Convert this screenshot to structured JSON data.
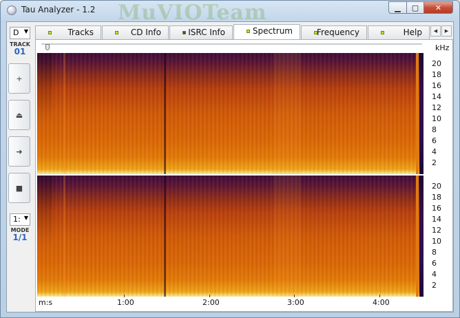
{
  "window": {
    "title": "Tau Analyzer - 1.2",
    "watermark": "MuVIOTeam"
  },
  "left_panel": {
    "drive_value": "D",
    "track_label": "TRACK",
    "track_value": "01",
    "mode_select_value": "1:",
    "mode_label": "MODE",
    "mode_value": "1/1",
    "buttons": [
      {
        "icon": "plus-icon",
        "glyph": "+"
      },
      {
        "icon": "eject-icon",
        "glyph": "⏏"
      },
      {
        "icon": "play-icon",
        "glyph": "➜"
      },
      {
        "icon": "stop-icon",
        "glyph": "■"
      }
    ]
  },
  "tabs": [
    {
      "label": "Tracks",
      "led_color": "#c8e800"
    },
    {
      "label": "CD Info",
      "led_color": "#c8e800"
    },
    {
      "label": "ISRC Info",
      "led_color": "#4a4a4a"
    },
    {
      "label": "Spectrum",
      "led_color": "#c8e800",
      "active": true
    },
    {
      "label": "Frequency",
      "led_color": "#c8e800"
    },
    {
      "label": "Help",
      "led_color": "#c8e800"
    }
  ],
  "spectrum": {
    "unit_label": "kHz",
    "freq_ticks": [
      "20",
      "18",
      "16",
      "14",
      "12",
      "10",
      "8",
      "6",
      "4",
      "2"
    ],
    "time_axis_label": "m:s",
    "time_ticks": [
      "1:00",
      "2:00",
      "3:00",
      "4:00"
    ],
    "channels": 2
  }
}
